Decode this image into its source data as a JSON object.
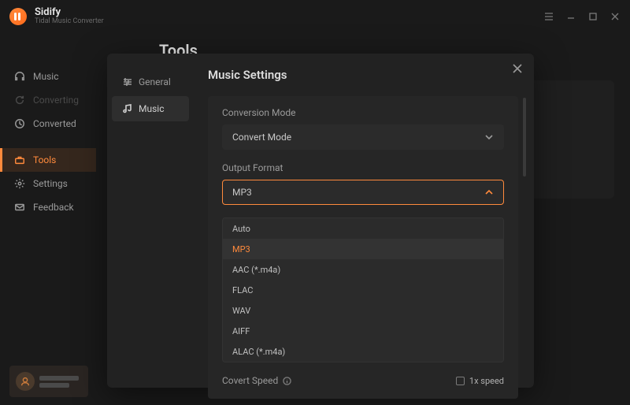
{
  "brand": {
    "name": "Sidify",
    "sub": "Tidal Music Converter"
  },
  "nav": {
    "music": "Music",
    "converting": "Converting",
    "converted": "Converted",
    "tools": "Tools",
    "settings": "Settings",
    "feedback": "Feedback"
  },
  "page": {
    "title": "Tools"
  },
  "modal": {
    "tabs": {
      "general": "General",
      "music": "Music"
    },
    "title": "Music Settings",
    "conversion_mode_label": "Conversion Mode",
    "conversion_mode_value": "Convert Mode",
    "output_format_label": "Output Format",
    "output_format_value": "MP3",
    "output_format_options": [
      "Auto",
      "MP3",
      "AAC (*.m4a)",
      "FLAC",
      "WAV",
      "AIFF",
      "ALAC (*.m4a)"
    ],
    "covert_speed_label": "Covert Speed",
    "speed_value": "1x speed"
  }
}
